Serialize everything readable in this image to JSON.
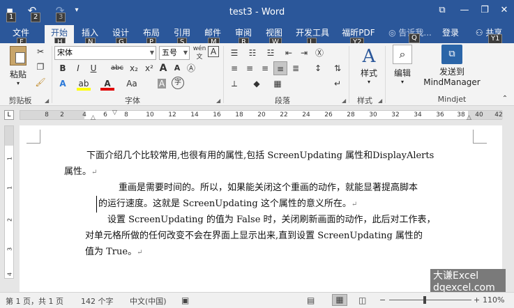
{
  "titlebar": {
    "title": "test3 - Word",
    "keytips": {
      "save": "1",
      "undo": "2",
      "redo": "3"
    },
    "window_buttons": {
      "ribbon_options": "⧉",
      "minimize": "—",
      "restore": "❐",
      "close": "✕"
    }
  },
  "tabs": [
    {
      "label": "文件",
      "keytip": "F"
    },
    {
      "label": "开始",
      "keytip": "H"
    },
    {
      "label": "插入",
      "keytip": "N"
    },
    {
      "label": "设计",
      "keytip": "G"
    },
    {
      "label": "布局",
      "keytip": "P"
    },
    {
      "label": "引用",
      "keytip": "S"
    },
    {
      "label": "邮件",
      "keytip": "M"
    },
    {
      "label": "审阅",
      "keytip": "R"
    },
    {
      "label": "视图",
      "keytip": "W"
    },
    {
      "label": "开发工具",
      "keytip": "L"
    },
    {
      "label": "福昕PDF",
      "keytip": "Y2"
    },
    {
      "label": "告诉我...",
      "keytip": "Q"
    },
    {
      "label": "登录",
      "keytip": ""
    },
    {
      "label": "共享",
      "keytip": "Y1"
    }
  ],
  "ribbon": {
    "clipboard": {
      "paste_label": "粘贴",
      "group_label": "剪贴板"
    },
    "font": {
      "font_name": "宋体",
      "font_size": "五号",
      "phonetic": "wén",
      "group_label": "字体",
      "buttons": {
        "bold": "B",
        "italic": "I",
        "underline": "U",
        "strike": "abc",
        "subscript": "x₂",
        "superscript": "x²",
        "change_case": "Aa",
        "grow": "A",
        "shrink": "A",
        "char_shading": "A",
        "enclose": "字"
      }
    },
    "paragraph": {
      "group_label": "段落"
    },
    "styles": {
      "label": "样式",
      "group_label": "样式"
    },
    "editing": {
      "label": "编辑"
    },
    "mindjet": {
      "send_label": "发送到",
      "app_label": "MindManager",
      "group_label": "Mindjet"
    }
  },
  "ruler": {
    "numbers": [
      "8",
      "2",
      "4",
      "6",
      "8",
      "10",
      "12",
      "14",
      "16",
      "18",
      "20",
      "22",
      "24",
      "26",
      "28",
      "30",
      "32",
      "34",
      "36",
      "38",
      "40",
      "42"
    ]
  },
  "vruler": {
    "numbers": [
      "1",
      "1",
      "2",
      "3",
      "4"
    ]
  },
  "document": {
    "paragraphs": [
      {
        "lines": [
          "下面介绍几个比较常用,也很有用的属性,包括 ScreenUpdating 属性和DisplayAlerts",
          "属性。"
        ]
      },
      {
        "lines": [
          "重画是需要时间的。所以，如果能关闭这个重画的动作，就能显著提高脚本",
          "的运行速度。这就是 ScreenUpdating 这个属性的意义所在。"
        ]
      },
      {
        "lines": [
          "设置 ScreenUpdating 的值为 False 时，关闭刷新画面的动作，此后对工作表，",
          "对单元格所做的任何改变不会在界面上显示出来,直到设置 ScreenUpdating 属性的",
          "值为 True。"
        ]
      }
    ],
    "para_mark": "↵"
  },
  "watermark": {
    "line1": "大谦Excel",
    "line2": "dqexcel.com"
  },
  "status": {
    "page": "第 1 页，共 1 页",
    "words": "142 个字",
    "language": "中文(中国)",
    "zoom": "110%"
  }
}
